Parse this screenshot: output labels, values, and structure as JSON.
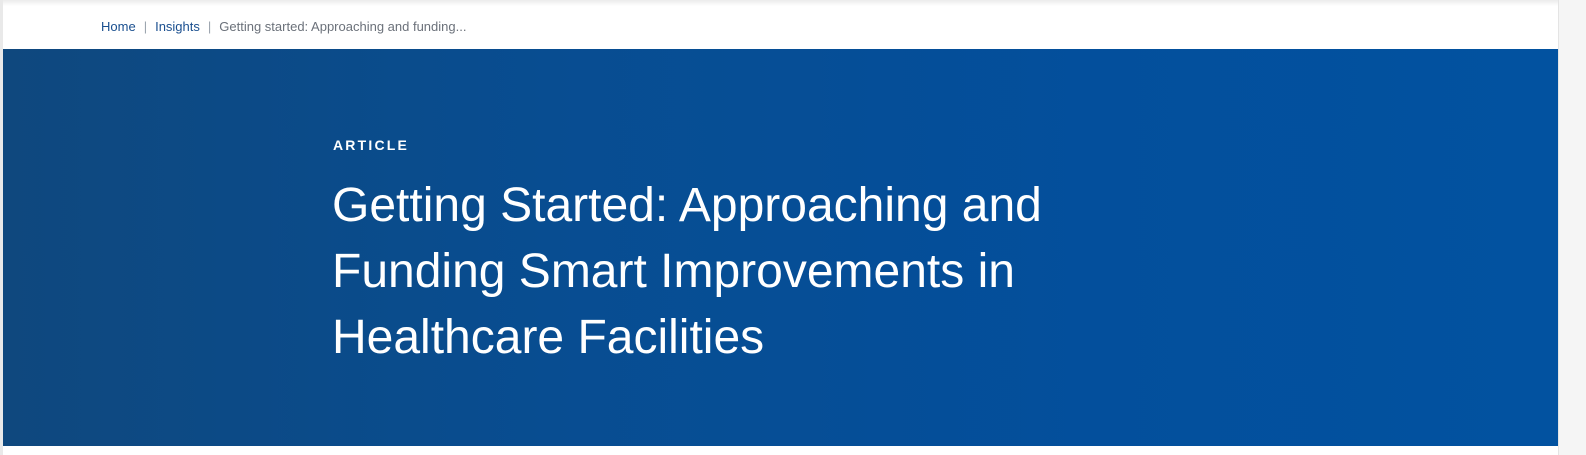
{
  "breadcrumb": {
    "items": [
      {
        "label": "Home"
      },
      {
        "label": "Insights"
      }
    ],
    "separator": "|",
    "current": "Getting started: Approaching and funding..."
  },
  "hero": {
    "eyebrow": "ARTICLE",
    "title": "Getting Started: Approaching and Funding Smart Improvements in Healthcare Facilities",
    "background_start": "#0f487e",
    "background_end": "#0252a0"
  },
  "colors": {
    "link": "#1a4f8f",
    "breadcrumb_current": "#6b717a",
    "separator": "#9aa3ad",
    "hero_text": "#ffffff"
  }
}
